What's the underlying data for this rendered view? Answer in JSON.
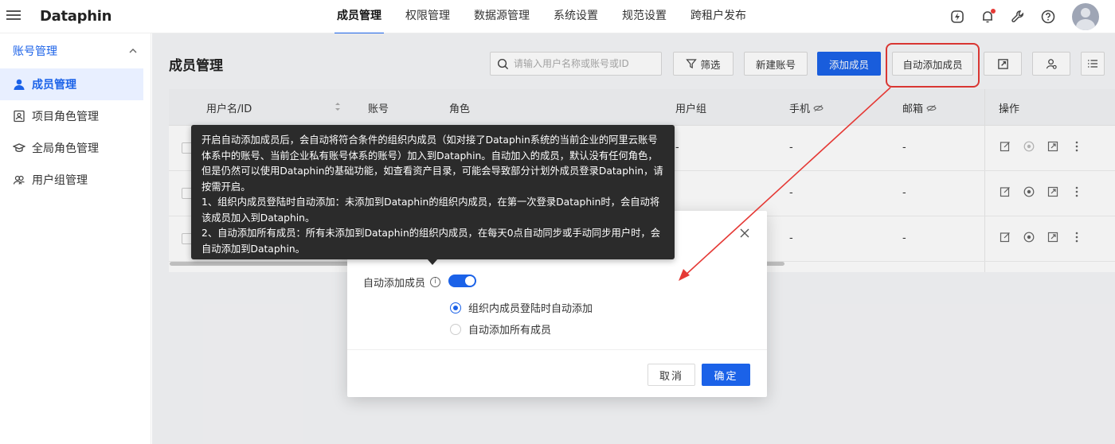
{
  "app": {
    "logo": "Dataphin"
  },
  "topnav": {
    "items": [
      "成员管理",
      "权限管理",
      "数据源管理",
      "系统设置",
      "规范设置",
      "跨租户发布"
    ],
    "active_index": 0
  },
  "top_icons": [
    "bolt-icon",
    "bell-icon",
    "wrench-icon",
    "help-icon"
  ],
  "sidebar": {
    "group_label": "账号管理",
    "items": [
      {
        "label": "成员管理",
        "icon": "user-icon",
        "active": true
      },
      {
        "label": "项目角色管理",
        "icon": "id-card-icon"
      },
      {
        "label": "全局角色管理",
        "icon": "graduation-cap-icon"
      },
      {
        "label": "用户组管理",
        "icon": "users-icon"
      }
    ]
  },
  "main": {
    "title": "成员管理",
    "search_placeholder": "请输入用户名称或账号或ID",
    "filter_label": "筛选",
    "new_account_label": "新建账号",
    "add_member_label": "添加成员",
    "auto_add_label": "自动添加成员"
  },
  "table": {
    "headers": [
      "用户名/ID",
      "账号",
      "角色",
      "用户组",
      "手机",
      "邮箱",
      "操作"
    ],
    "rows": [
      {
        "role": "-",
        "phone": "-",
        "email": "-"
      },
      {
        "role": "",
        "phone": "-",
        "email": "-"
      },
      {
        "role": "",
        "phone": "-",
        "email": "-"
      }
    ]
  },
  "tooltip": {
    "paragraphs": [
      "开启自动添加成员后，会自动将符合条件的组织内成员（如对接了Dataphin系统的当前企业的阿里云账号体系中的账号、当前企业私有账号体系的账号）加入到Dataphin。自动加入的成员，默认没有任何角色，但是仍然可以使用Dataphin的基础功能，如查看资产目录，可能会导致部分计划外成员登录Dataphin，请按需开启。",
      "1、组织内成员登陆时自动添加：未添加到Dataphin的组织内成员，在第一次登录Dataphin时，会自动将该成员加入到Dataphin。",
      "2、自动添加所有成员：所有未添加到Dataphin的组织内成员，在每天0点自动同步或手动同步用户时，会自动添加到Dataphin。"
    ]
  },
  "modal": {
    "field_label": "自动添加成员",
    "toggle_on": true,
    "options": [
      {
        "label": "组织内成员登陆时自动添加",
        "checked": true
      },
      {
        "label": "自动添加所有成员",
        "checked": false
      }
    ],
    "cancel_label": "取消",
    "ok_label": "确定"
  },
  "colors": {
    "primary": "#1b62e8",
    "highlight": "#e53935",
    "tooltip_bg": "#2b2b2b"
  }
}
